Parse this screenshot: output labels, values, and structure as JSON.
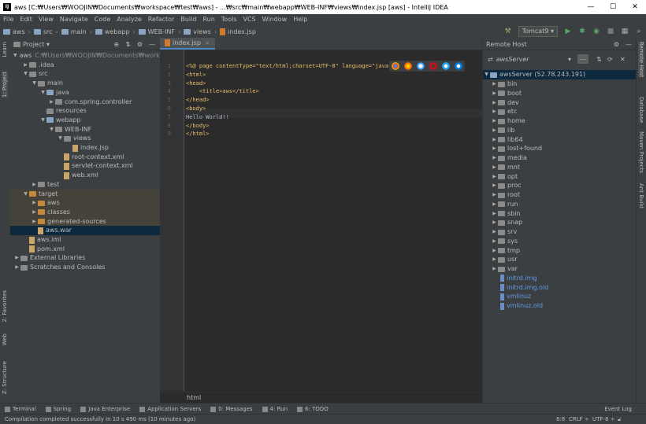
{
  "window": {
    "title": "aws [C:₩Users₩WOOJIN₩Documents₩workspace₩test₩aws] - ...₩src₩main₩webapp₩WEB-INF₩views₩index.jsp [aws] - IntelliJ IDEA",
    "app_icon": "IJ",
    "minimize": "—",
    "maximize": "☐",
    "close": "✕"
  },
  "menu": [
    "File",
    "Edit",
    "View",
    "Navigate",
    "Code",
    "Analyze",
    "Refactor",
    "Build",
    "Run",
    "Tools",
    "VCS",
    "Window",
    "Help"
  ],
  "breadcrumb": [
    "aws",
    "src",
    "main",
    "webapp",
    "WEB-INF",
    "views",
    "index.jsp"
  ],
  "toolbar": {
    "run_config": "Tomcat9 ▾"
  },
  "left_strip": {
    "learn": "Learn",
    "project": "1: Project",
    "favorites": "2: Favorites",
    "web": "Web",
    "structure": "Z: Structure"
  },
  "right_strip": {
    "remote_host": "Remote Host",
    "database": "Database",
    "maven": "Maven Projects",
    "ant": "Ant Build"
  },
  "project_panel": {
    "header": "Project ▾",
    "tree": [
      {
        "label": "aws",
        "path": "C:₩Users₩WOOJIN₩Documents₩workspace₩t",
        "indent": 0,
        "arrow": "▼",
        "icon": "gray"
      },
      {
        "label": ".idea",
        "indent": 1,
        "arrow": "▶",
        "icon": "gray"
      },
      {
        "label": "src",
        "indent": 1,
        "arrow": "▼",
        "icon": "gray"
      },
      {
        "label": "main",
        "indent": 2,
        "arrow": "▼",
        "icon": "gray"
      },
      {
        "label": "java",
        "indent": 3,
        "arrow": "▼",
        "icon": "blue"
      },
      {
        "label": "com.spring.controller",
        "indent": 4,
        "arrow": "▶",
        "icon": "gray"
      },
      {
        "label": "resources",
        "indent": 3,
        "arrow": "",
        "icon": "gray"
      },
      {
        "label": "webapp",
        "indent": 3,
        "arrow": "▼",
        "icon": "blue"
      },
      {
        "label": "WEB-INF",
        "indent": 4,
        "arrow": "▼",
        "icon": "gray"
      },
      {
        "label": "views",
        "indent": 5,
        "arrow": "▼",
        "icon": "gray"
      },
      {
        "label": "index.jsp",
        "indent": 6,
        "arrow": "",
        "icon": "file"
      },
      {
        "label": "root-context.xml",
        "indent": 5,
        "arrow": "",
        "icon": "file"
      },
      {
        "label": "servlet-context.xml",
        "indent": 5,
        "arrow": "",
        "icon": "file"
      },
      {
        "label": "web.xml",
        "indent": 5,
        "arrow": "",
        "icon": "file"
      },
      {
        "label": "test",
        "indent": 2,
        "arrow": "▶",
        "icon": "gray"
      },
      {
        "label": "target",
        "indent": 1,
        "arrow": "▼",
        "icon": "orange",
        "excluded": true
      },
      {
        "label": "aws",
        "indent": 2,
        "arrow": "▶",
        "icon": "orange",
        "excluded": true
      },
      {
        "label": "classes",
        "indent": 2,
        "arrow": "▶",
        "icon": "orange",
        "excluded": true
      },
      {
        "label": "generated-sources",
        "indent": 2,
        "arrow": "▶",
        "icon": "orange",
        "excluded": true
      },
      {
        "label": "aws.war",
        "indent": 2,
        "arrow": "",
        "icon": "file",
        "selected": true
      },
      {
        "label": "aws.iml",
        "indent": 1,
        "arrow": "",
        "icon": "file"
      },
      {
        "label": "pom.xml",
        "indent": 1,
        "arrow": "",
        "icon": "file"
      },
      {
        "label": "External Libraries",
        "indent": 0,
        "arrow": "▶",
        "icon": "gray"
      },
      {
        "label": "Scratches and Consoles",
        "indent": 0,
        "arrow": "▶",
        "icon": "gray"
      }
    ]
  },
  "editor": {
    "tab": "index.jsp",
    "lines": [
      "<%@ page contentType=\"text/html;charset=UTF-8\" language=\"java\" %>",
      "<html>",
      "<head>",
      "    <title>aws</title>",
      "</head>",
      "<body>",
      "Hello World!!",
      "</body>",
      "</html>"
    ],
    "line_numbers": [
      "1",
      "2",
      "3",
      "4",
      "5",
      "6",
      "7",
      "8",
      "9"
    ],
    "status_path": "html"
  },
  "remote_host": {
    "header": "Remote Host",
    "server": "awsServer",
    "root_label": "awsServer (52.78.243.191)",
    "items": [
      "bin",
      "boot",
      "dev",
      "etc",
      "home",
      "lib",
      "lib64",
      "lost+found",
      "media",
      "mnt",
      "opt",
      "proc",
      "root",
      "run",
      "sbin",
      "snap",
      "srv",
      "sys",
      "tmp",
      "usr",
      "var"
    ],
    "files": [
      "initrd.img",
      "initrd.img.old",
      "vmlinuz",
      "vmlinuz.old"
    ]
  },
  "bottom_tools": [
    "Terminal",
    "Spring",
    "Java Enterprise",
    "Application Servers",
    "0: Messages",
    "4: Run",
    "6: TODO"
  ],
  "event_log": "Event Log",
  "status": {
    "message": "Compilation completed successfully in 10 s 490 ms (10 minutes ago)",
    "position": "8:8",
    "line_sep": "CRLF ÷",
    "encoding": "UTF-8 ÷"
  },
  "colors": {
    "accent": "#4a88c7",
    "selected_row": "#0d293e",
    "excluded": "#45423a",
    "folder_blue": "#8aa5c3",
    "folder_orange": "#c5883a"
  }
}
